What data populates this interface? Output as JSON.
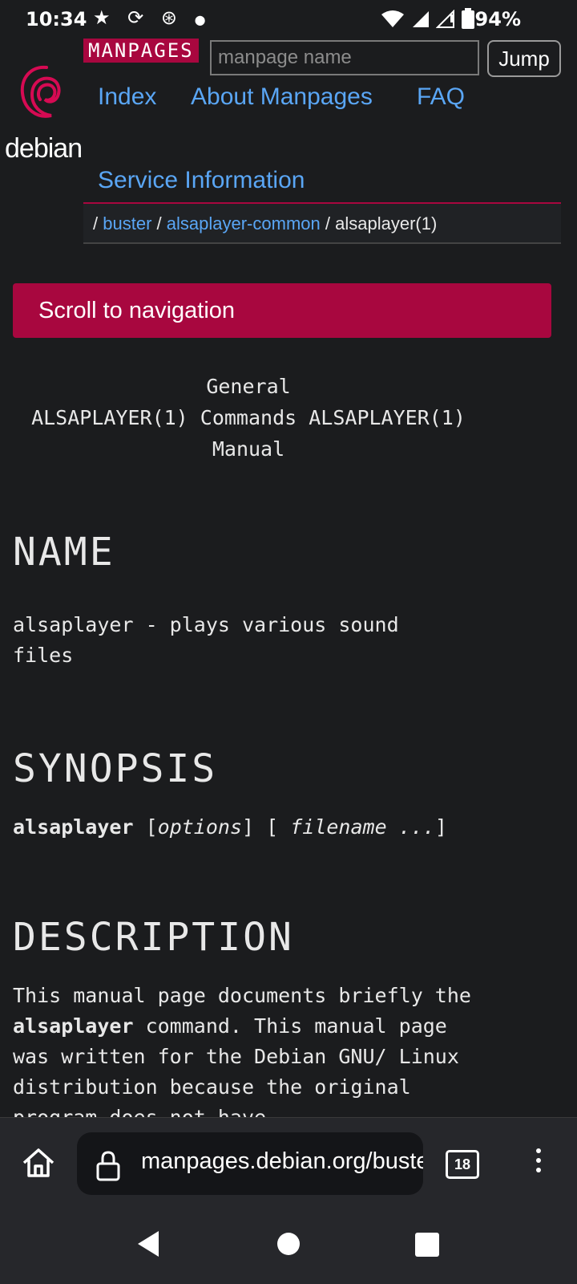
{
  "status_bar": {
    "time": "10:34",
    "battery": "94%",
    "icons": [
      "star-icon",
      "sync-icon",
      "hotspot-icon",
      "dot-icon",
      "wifi-icon",
      "signal-icon",
      "signal-alt-icon",
      "battery-icon"
    ]
  },
  "header": {
    "logo_text": "debian",
    "tag": "MANPAGES",
    "search": {
      "placeholder": "manpage name",
      "value": ""
    },
    "jump_label": "Jump",
    "nav": {
      "index": "Index",
      "about": "About Manpages",
      "faq": "FAQ",
      "service": "Service Information"
    },
    "breadcrumb": {
      "sep1": "/",
      "item1": "buster",
      "sep2": "/",
      "item2": "alsaplayer-common",
      "sep3": "/",
      "current": "alsaplayer(1)"
    }
  },
  "scroll_button": "Scroll to navigation",
  "man": {
    "header_line1": "General",
    "header_line2": "ALSAPLAYER(1) Commands ALSAPLAYER(1)",
    "header_line3": "Manual",
    "name_title": "NAME",
    "name_text": "alsaplayer - plays various sound files",
    "synopsis_title": "SYNOPSIS",
    "synopsis_cmd": "alsaplayer",
    "synopsis_open1": "[",
    "synopsis_options": "options",
    "synopsis_close1": "] [",
    "synopsis_filename": "filename ...",
    "synopsis_close2": "]",
    "description_title": "DESCRIPTION",
    "description_pre": "This manual page documents briefly the",
    "description_cmd": "alsaplayer",
    "description_post": "command. This manual page was written for the Debian GNU/ Linux distribution because the",
    "description_cut": "original program does not have"
  },
  "browser": {
    "url": "manpages.debian.org/buster/alsaplayer-common",
    "tabs_count": "18"
  }
}
